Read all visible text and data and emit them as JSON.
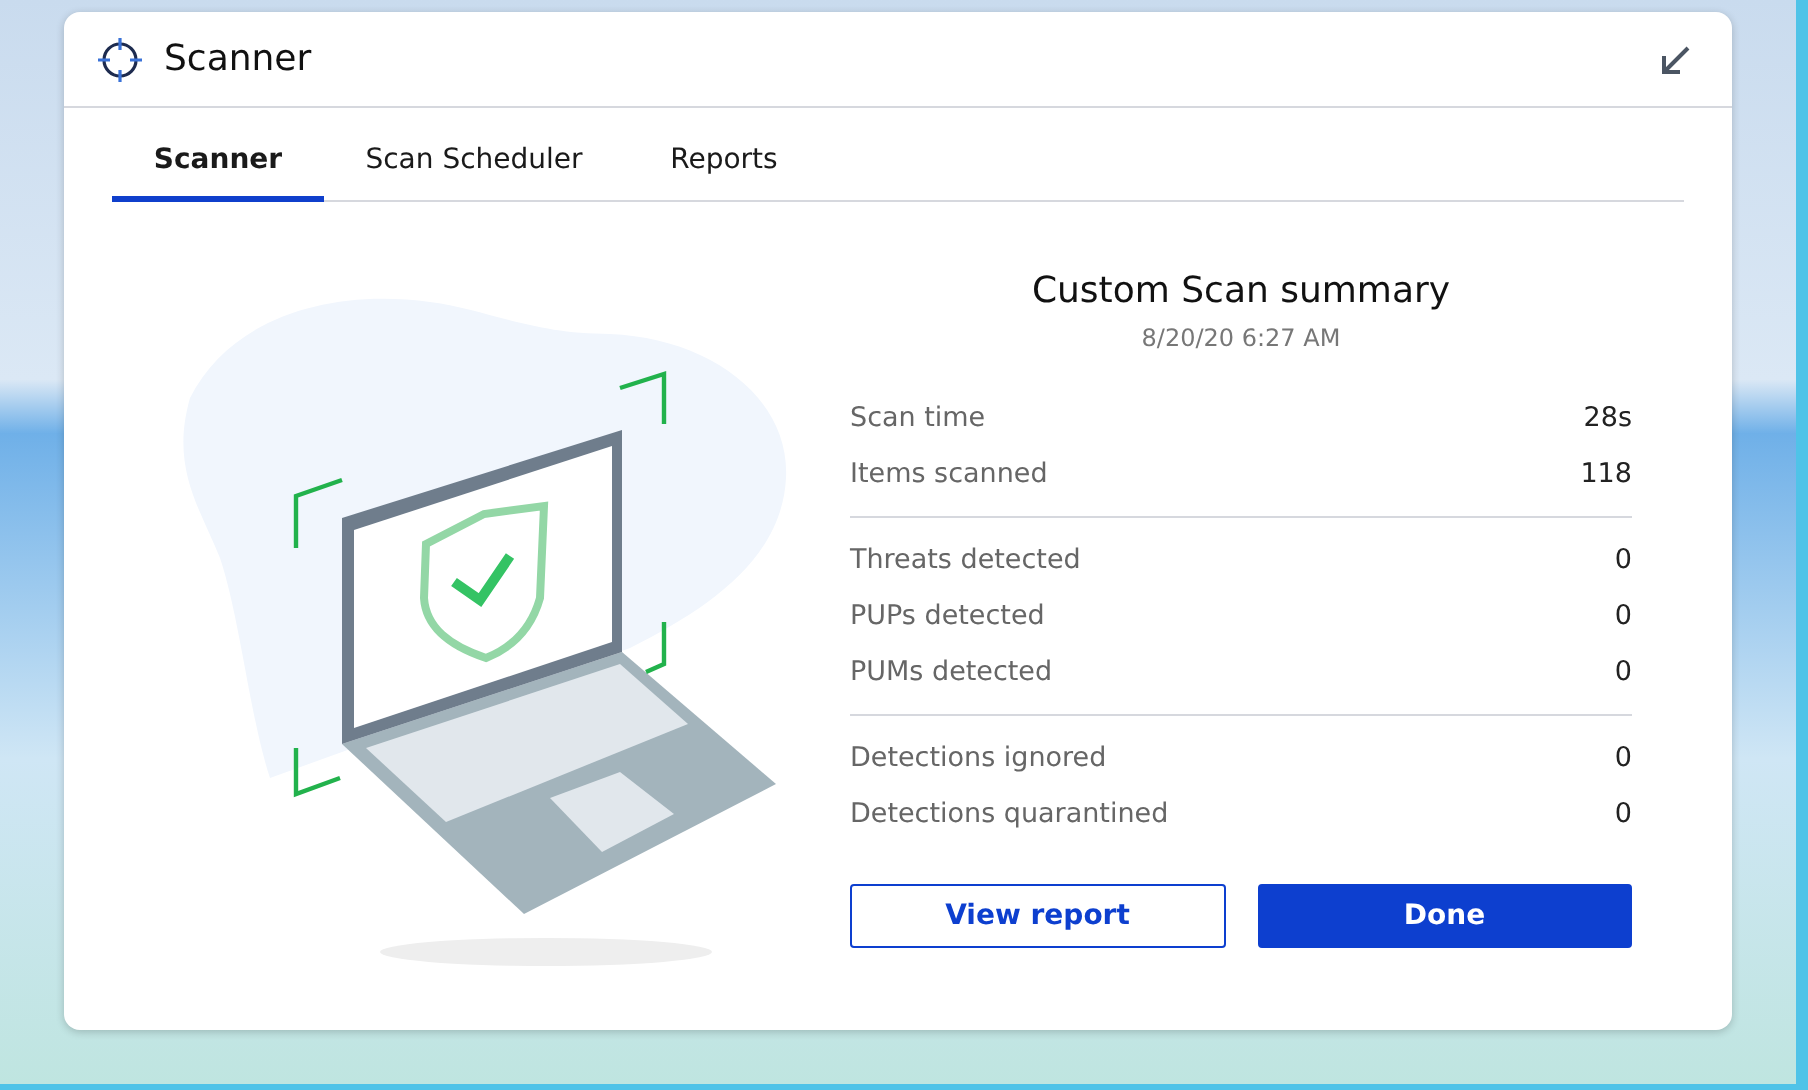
{
  "window": {
    "title": "Scanner"
  },
  "tabs": [
    {
      "label": "Scanner",
      "selected": true
    },
    {
      "label": "Scan Scheduler",
      "selected": false
    },
    {
      "label": "Reports",
      "selected": false
    }
  ],
  "summary": {
    "title": "Custom Scan summary",
    "timestamp": "8/20/20 6:27 AM",
    "groups": [
      [
        {
          "label": "Scan time",
          "value": "28s"
        },
        {
          "label": "Items scanned",
          "value": "118"
        }
      ],
      [
        {
          "label": "Threats detected",
          "value": "0"
        },
        {
          "label": "PUPs detected",
          "value": "0"
        },
        {
          "label": "PUMs detected",
          "value": "0"
        }
      ],
      [
        {
          "label": "Detections ignored",
          "value": "0"
        },
        {
          "label": "Detections quarantined",
          "value": "0"
        }
      ]
    ]
  },
  "buttons": [
    {
      "label": "View report",
      "kind": "secondary"
    },
    {
      "label": "Done",
      "kind": "primary"
    }
  ]
}
